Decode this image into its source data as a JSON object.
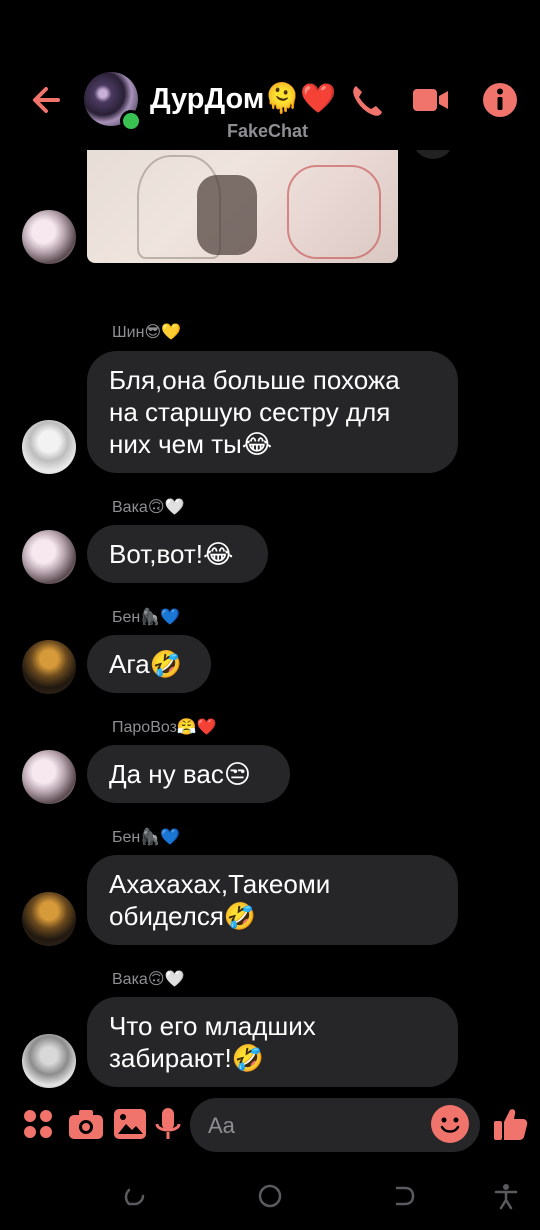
{
  "header": {
    "title": "ДурДом🫠❤️",
    "subtitle": "FakeChat",
    "accent_color": "#f0736c",
    "icons": [
      "back-arrow-icon",
      "phone-icon",
      "video-camera-icon",
      "info-icon"
    ]
  },
  "messages": [
    {
      "sender": "Шин😎💛",
      "text": "Бля,она больше похожа\nна старшую сестру для\nних чем ты😂"
    },
    {
      "sender": "Вака🙃🤍",
      "text": "Вот,вот!😂"
    },
    {
      "sender": "Бен🦍💙",
      "text": "Ага🤣"
    },
    {
      "sender": "ПароВоз😤❤️",
      "text": "Да ну вас😒"
    },
    {
      "sender": "Бен🦍💙",
      "text": "Ахахахах,Такеоми\nобиделся🤣"
    },
    {
      "sender": "Вака🙃🤍",
      "text": "Что его младших\nзабирают!🤣"
    }
  ],
  "composer": {
    "placeholder": "Aa",
    "icons": [
      "apps-icon",
      "camera-icon",
      "gallery-icon",
      "microphone-icon",
      "emoji-icon",
      "thumbs-up-icon"
    ]
  },
  "navbar": {
    "icons": [
      "recent-apps-icon",
      "home-icon",
      "back-icon",
      "accessibility-icon"
    ]
  }
}
